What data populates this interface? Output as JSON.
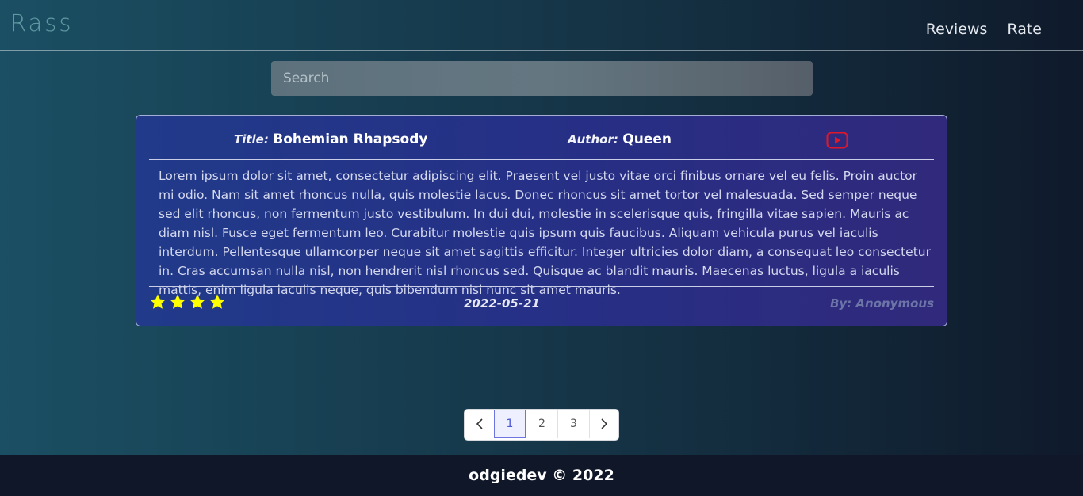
{
  "navbar": {
    "brand": "Rass",
    "links": [
      "Reviews",
      "Rate"
    ]
  },
  "search": {
    "placeholder": "Search",
    "value": ""
  },
  "review": {
    "title_label": "Title:",
    "title": "Bohemian Rhapsody",
    "author_label": "Author:",
    "author": "Queen",
    "link_icon": "youtube-icon",
    "body": "Lorem ipsum dolor sit amet, consectetur adipiscing elit. Praesent vel justo vitae orci finibus ornare vel eu felis. Proin auctor mi odio. Nam sit amet rhoncus nulla, quis molestie lacus. Donec rhoncus sit amet tortor vel malesuada. Sed semper neque sed elit rhoncus, non fermentum justo vestibulum. In dui dui, molestie in scelerisque quis, fringilla vitae sapien. Mauris ac diam nisl. Fusce eget fermentum leo. Curabitur molestie quis ipsum quis faucibus. Aliquam vehicula purus vel iaculis interdum. Pellentesque ullamcorper neque sit amet sagittis efficitur. Integer ultricies dolor diam, a consequat leo consectetur in. Cras accumsan nulla nisl, non hendrerit nisl rhoncus sed. Quisque ac blandit mauris. Maecenas luctus, ligula a iaculis mattis, enim ligula iaculis neque, quis bibendum nisi nunc sit amet mauris.",
    "rating": 4,
    "date": "2022-05-21",
    "byline": "By: Anonymous"
  },
  "pagination": {
    "prev_icon": "chevron-left-icon",
    "pages": [
      "1",
      "2",
      "3"
    ],
    "active": "1",
    "next_icon": "chevron-right-icon"
  },
  "footer": {
    "text": "odgiedev © 2022"
  },
  "colors": {
    "star": "#ffff00",
    "youtube": "#e0162b",
    "accent": "#4a58d6"
  }
}
